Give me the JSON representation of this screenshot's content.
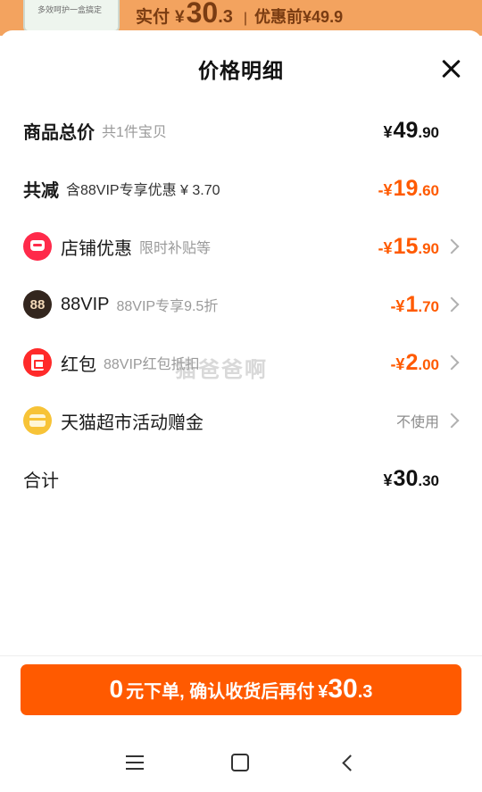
{
  "background": {
    "thumb_text": "多效呵护一盒搞定",
    "price_label": "实付",
    "price_yen": "¥",
    "price_int": "30",
    "price_dec": ".3",
    "separator": "|",
    "before_label": "优惠前¥49.9"
  },
  "sheet": {
    "title": "价格明细",
    "close_icon": "close-icon"
  },
  "rows": [
    {
      "label": "商品总价",
      "sub": "共1件宝贝",
      "yen": "¥",
      "int": "49",
      "dec": ".90"
    },
    {
      "label": "共减",
      "sub": "含88VIP专享优惠 ¥ 3.70",
      "yen": "-¥",
      "int": "19",
      "dec": ".60"
    },
    {
      "label": "店铺优惠",
      "sub": "限时补贴等",
      "yen": "-¥",
      "int": "15",
      "dec": ".90",
      "icon": "shop-icon"
    },
    {
      "label": "88VIP",
      "sub": "88VIP专享9.5折",
      "yen": "-¥",
      "int": "1",
      "dec": ".70",
      "icon": "vip-badge-icon",
      "icon_text": "88"
    },
    {
      "label": "红包",
      "sub": "88VIP红包抵扣",
      "yen": "-¥",
      "int": "2",
      "dec": ".00",
      "icon": "red-envelope-icon"
    },
    {
      "label": "天猫超市活动赠金",
      "value": "不使用",
      "icon": "wallet-icon"
    },
    {
      "label": "合计",
      "yen": "¥",
      "int": "30",
      "dec": ".30"
    }
  ],
  "watermark": "猫爸爸啊",
  "cta": {
    "zero": "0",
    "text": "元下单, 确认收货后再付",
    "yen": "¥",
    "int": "30",
    "dec": ".3"
  },
  "colors": {
    "accent": "#ff5a00",
    "shop_icon": "#ff2a4a",
    "vip_icon": "#33261e",
    "red_envelope_icon": "#ff2a2a",
    "wallet_icon": "#f7c337"
  },
  "nav": {
    "menu_icon": "menu-icon",
    "home_icon": "home-icon",
    "back_icon": "back-icon"
  }
}
